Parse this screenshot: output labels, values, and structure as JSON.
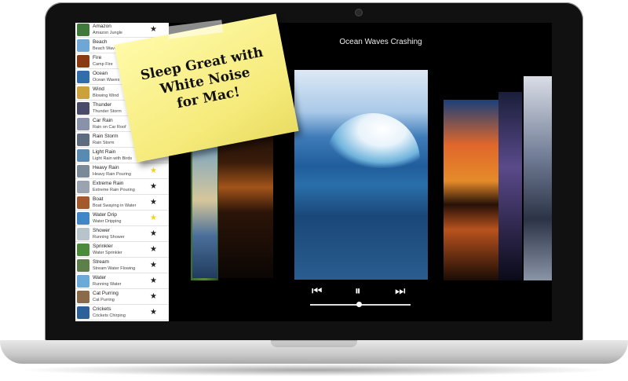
{
  "now_playing": "Ocean Waves Crashing",
  "sticky_note": "Sleep Great with\nWhite Noise\nfor Mac!",
  "sounds": [
    {
      "title": "Amazon",
      "subtitle": "Amazon Jungle",
      "favorite": false,
      "color": "#3f7a3a"
    },
    {
      "title": "Beach",
      "subtitle": "Beach Waves Crashing",
      "favorite": true,
      "color": "#6ea6d6"
    },
    {
      "title": "Fire",
      "subtitle": "Camp Fire",
      "favorite": false,
      "color": "#8a3a12"
    },
    {
      "title": "Ocean",
      "subtitle": "Ocean Waves Crashing",
      "favorite": false,
      "color": "#2f6ea8"
    },
    {
      "title": "Wind",
      "subtitle": "Blowing Wind",
      "favorite": false,
      "color": "#c9a23a"
    },
    {
      "title": "Thunder",
      "subtitle": "Thunder Storm",
      "favorite": false,
      "color": "#4a4a6a"
    },
    {
      "title": "Car Rain",
      "subtitle": "Rain on Car Roof",
      "favorite": false,
      "color": "#8892a8"
    },
    {
      "title": "Rain Storm",
      "subtitle": "Rain Storm",
      "favorite": false,
      "color": "#5d6c80"
    },
    {
      "title": "Light Rain",
      "subtitle": "Light Rain with Birds",
      "favorite": false,
      "color": "#5a8ab0"
    },
    {
      "title": "Heavy Rain",
      "subtitle": "Heavy Rain Pouring",
      "favorite": true,
      "color": "#7a8a98"
    },
    {
      "title": "Extreme Rain",
      "subtitle": "Extreme Rain Pouring",
      "favorite": false,
      "color": "#9aa4b0"
    },
    {
      "title": "Boat",
      "subtitle": "Boat Swaying in Water",
      "favorite": false,
      "color": "#a35a2a"
    },
    {
      "title": "Water Drip",
      "subtitle": "Water Dripping",
      "favorite": true,
      "color": "#3f87c6"
    },
    {
      "title": "Shower",
      "subtitle": "Running Shower",
      "favorite": false,
      "color": "#b8c4cc"
    },
    {
      "title": "Sprinkler",
      "subtitle": "Water Sprinkler",
      "favorite": false,
      "color": "#4c8a3c"
    },
    {
      "title": "Stream",
      "subtitle": "Stream Water Flowing",
      "favorite": false,
      "color": "#5d7f4a"
    },
    {
      "title": "Water",
      "subtitle": "Running Water",
      "favorite": false,
      "color": "#6aa9d8"
    },
    {
      "title": "Cat Purring",
      "subtitle": "Cat Purring",
      "favorite": false,
      "color": "#8a6a48"
    },
    {
      "title": "Crickets",
      "subtitle": "Crickets Chirping",
      "favorite": false,
      "color": "#2d5f9a"
    }
  ],
  "controls": {
    "previous": "⏮",
    "pause": "⏸",
    "next": "⏭"
  },
  "playback_progress": 0.49,
  "colors": {
    "favorite_star": "#f2d21b",
    "star": "#222222"
  }
}
